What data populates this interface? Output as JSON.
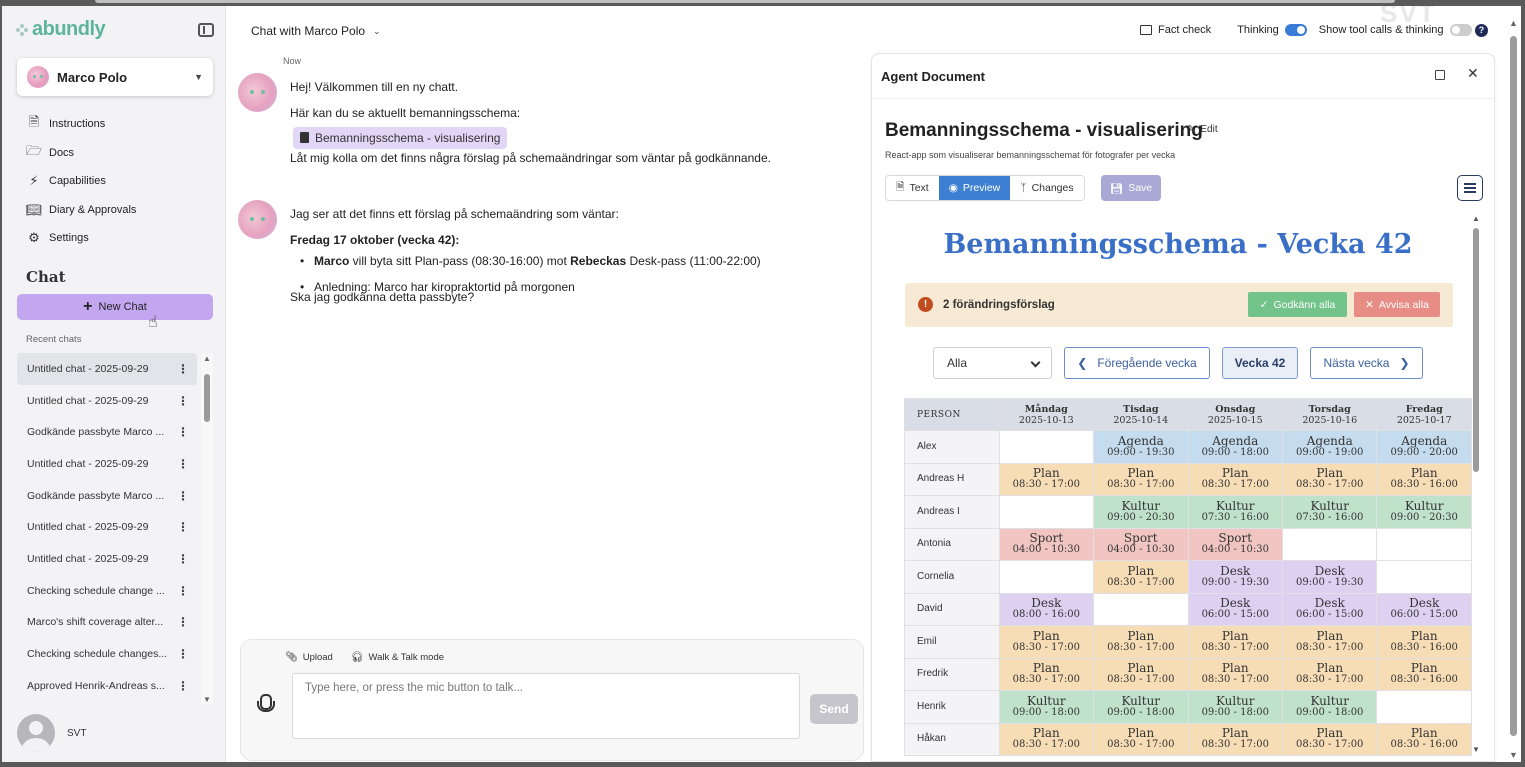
{
  "app": {
    "logo": "abundly",
    "agent_name": "Marco Polo",
    "user_name": "SVT",
    "watermark": "SVT"
  },
  "sidebar": {
    "items": [
      {
        "label": "Instructions",
        "icon": "document-icon"
      },
      {
        "label": "Docs",
        "icon": "folder-icon"
      },
      {
        "label": "Capabilities",
        "icon": "lightning-icon"
      },
      {
        "label": "Diary & Approvals",
        "icon": "book-icon"
      },
      {
        "label": "Settings",
        "icon": "gear-icon"
      }
    ],
    "chat_title": "Chat",
    "new_chat_label": "New Chat",
    "recent_label": "Recent chats",
    "recent": [
      "Untitled chat - 2025-09-29",
      "Untitled chat - 2025-09-29",
      "Godkände passbyte Marco ...",
      "Untitled chat - 2025-09-29",
      "Godkände passbyte Marco ...",
      "Untitled chat - 2025-09-29",
      "Untitled chat - 2025-09-29",
      "Checking schedule change ...",
      "Marco's shift coverage alter...",
      "Checking schedule changes...",
      "Approved Henrik-Andreas s..."
    ]
  },
  "chat": {
    "header": "Chat with Marco Polo",
    "time": "Now",
    "msg1": {
      "line1": "Hej! Välkommen till en ny chatt.",
      "line2": "Här kan du se aktuellt bemanningsschema:",
      "chip": "Bemanningsschema - visualisering",
      "line3": "Låt mig kolla om det finns några förslag på schemaändringar som väntar på godkännande."
    },
    "msg2": {
      "line1": "Jag ser att det finns ett förslag på schemaändring som väntar:",
      "heading": "Fredag 17 oktober (vecka 42):",
      "b1_name1": "Marco",
      "b1_mid": " vill byta sitt Plan-pass (08:30-16:00) mot ",
      "b1_name2": "Rebeckas",
      "b1_end": " Desk-pass (11:00-22:00)",
      "b2": "Anledning: Marco har kiropraktortid på morgonen",
      "question": "Ska jag godkänna detta passbyte?"
    },
    "input": {
      "upload": "Upload",
      "walk_talk": "Walk & Talk mode",
      "placeholder": "Type here, or press the mic button to talk...",
      "send": "Send"
    }
  },
  "top": {
    "fact_check": "Fact check",
    "thinking": "Thinking",
    "show_tools": "Show tool calls & thinking",
    "help": "?"
  },
  "doc": {
    "panel_title": "Agent Document",
    "title": "Bemanningsschema - visualisering",
    "edit": "Edit",
    "subtitle": "React-app som visualiserar bemanningsschemat för fotografer per vecka",
    "tabs": {
      "text": "Text",
      "preview": "Preview",
      "changes": "Changes"
    },
    "save": "Save"
  },
  "schedule": {
    "title": "Bemanningsschema - Vecka 42",
    "alert": "2 förändringsförslag",
    "approve": "Godkänn alla",
    "reject": "Avvisa alla",
    "filter": "Alla",
    "prev": "Föregående vecka",
    "current": "Vecka 42",
    "next": "Nästa vecka",
    "person_header": "PERSON",
    "days": [
      {
        "name": "Måndag",
        "date": "2025-10-13"
      },
      {
        "name": "Tisdag",
        "date": "2025-10-14"
      },
      {
        "name": "Onsdag",
        "date": "2025-10-15"
      },
      {
        "name": "Torsdag",
        "date": "2025-10-16"
      },
      {
        "name": "Fredag",
        "date": "2025-10-17"
      }
    ],
    "rows": [
      {
        "name": "Alex",
        "cells": [
          null,
          [
            "Agenda",
            "09:00 - 19:30"
          ],
          [
            "Agenda",
            "09:00 - 18:00"
          ],
          [
            "Agenda",
            "09:00 - 19:00"
          ],
          [
            "Agenda",
            "09:00 - 20:00"
          ]
        ]
      },
      {
        "name": "Andreas H",
        "cells": [
          [
            "Plan",
            "08:30 - 17:00"
          ],
          [
            "Plan",
            "08:30 - 17:00"
          ],
          [
            "Plan",
            "08:30 - 17:00"
          ],
          [
            "Plan",
            "08:30 - 17:00"
          ],
          [
            "Plan",
            "08:30 - 16:00"
          ]
        ]
      },
      {
        "name": "Andreas I",
        "cells": [
          null,
          [
            "Kultur",
            "09:00 - 20:30"
          ],
          [
            "Kultur",
            "07:30 - 16:00"
          ],
          [
            "Kultur",
            "07:30 - 16:00"
          ],
          [
            "Kultur",
            "09:00 - 20:30"
          ]
        ]
      },
      {
        "name": "Antonia",
        "cells": [
          [
            "Sport",
            "04:00 - 10:30"
          ],
          [
            "Sport",
            "04:00 - 10:30"
          ],
          [
            "Sport",
            "04:00 - 10:30"
          ],
          null,
          null
        ]
      },
      {
        "name": "Cornelia",
        "cells": [
          null,
          [
            "Plan",
            "08:30 - 17:00"
          ],
          [
            "Desk",
            "09:00 - 19:30"
          ],
          [
            "Desk",
            "09:00 - 19:30"
          ],
          null
        ]
      },
      {
        "name": "David",
        "cells": [
          [
            "Desk",
            "08:00 - 16:00"
          ],
          null,
          [
            "Desk",
            "06:00 - 15:00"
          ],
          [
            "Desk",
            "06:00 - 15:00"
          ],
          [
            "Desk",
            "06:00 - 15:00"
          ]
        ]
      },
      {
        "name": "Emil",
        "cells": [
          [
            "Plan",
            "08:30 - 17:00"
          ],
          [
            "Plan",
            "08:30 - 17:00"
          ],
          [
            "Plan",
            "08:30 - 17:00"
          ],
          [
            "Plan",
            "08:30 - 17:00"
          ],
          [
            "Plan",
            "08:30 - 16:00"
          ]
        ]
      },
      {
        "name": "Fredrik",
        "cells": [
          [
            "Plan",
            "08:30 - 17:00"
          ],
          [
            "Plan",
            "08:30 - 17:00"
          ],
          [
            "Plan",
            "08:30 - 17:00"
          ],
          [
            "Plan",
            "08:30 - 17:00"
          ],
          [
            "Plan",
            "08:30 - 16:00"
          ]
        ]
      },
      {
        "name": "Henrik",
        "cells": [
          [
            "Kultur",
            "09:00 - 18:00"
          ],
          [
            "Kultur",
            "09:00 - 18:00"
          ],
          [
            "Kultur",
            "09:00 - 18:00"
          ],
          [
            "Kultur",
            "09:00 - 18:00"
          ],
          null
        ]
      },
      {
        "name": "Håkan",
        "cells": [
          [
            "Plan",
            "08:30 - 17:00"
          ],
          [
            "Plan",
            "08:30 - 17:00"
          ],
          [
            "Plan",
            "08:30 - 17:00"
          ],
          [
            "Plan",
            "08:30 - 17:00"
          ],
          [
            "Plan",
            "08:30 - 16:00"
          ]
        ]
      }
    ],
    "colors": {
      "Agenda": "#c5dcee",
      "Plan": "#f7ddb6",
      "Kultur": "#c0e2cb",
      "Sport": "#f1c6c2",
      "Desk": "#ddd0f1"
    }
  }
}
